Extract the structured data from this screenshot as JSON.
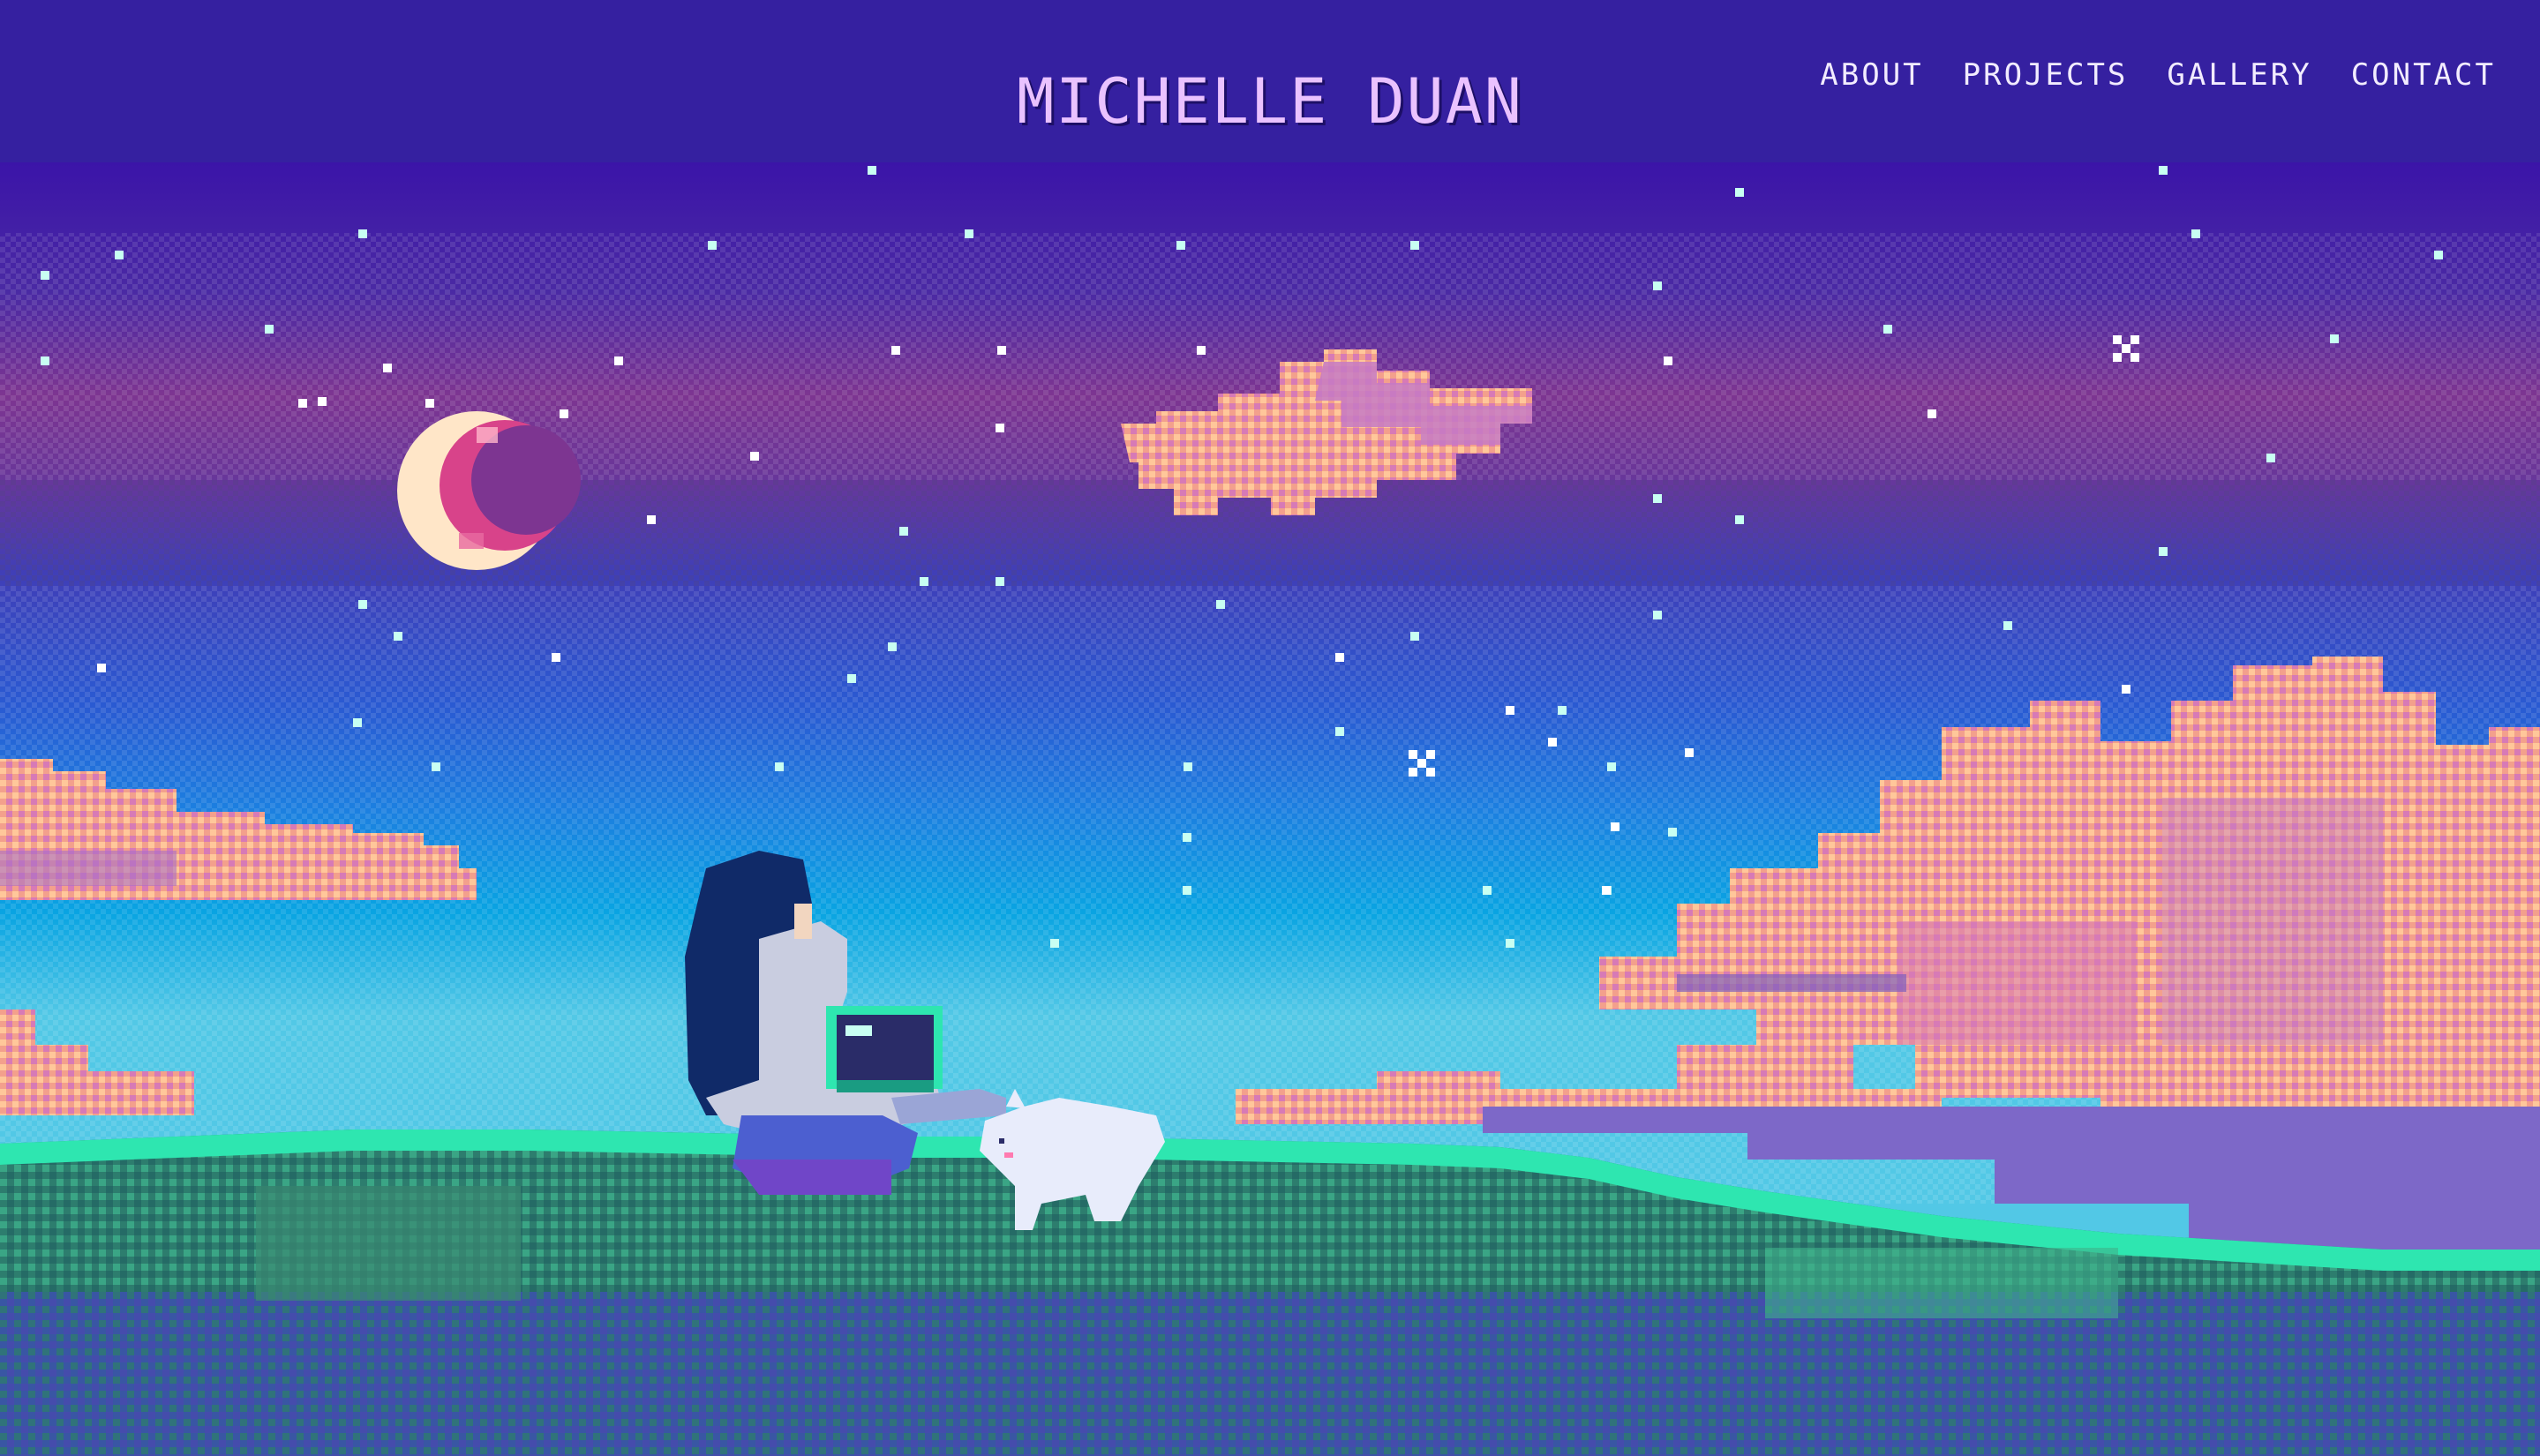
{
  "header": {
    "title": "MICHELLE DUAN",
    "nav": [
      {
        "label": "ABOUT"
      },
      {
        "label": "PROJECTS"
      },
      {
        "label": "GALLERY"
      },
      {
        "label": "CONTACT"
      }
    ]
  },
  "colors": {
    "header_bg": "#3520a0",
    "title_text": "#eac2ff",
    "nav_text": "#f2ecff",
    "sky_top": "#3b14a8",
    "sky_mid": "#7d3591",
    "sky_blue": "#2a64d8",
    "sky_light": "#09a4e2",
    "cloud_peach": "#ffb18e",
    "cloud_pink": "#e07ab6",
    "grass_bright": "#2ee6b0",
    "grass_dark": "#2d7d6e",
    "moon_light": "#ffe6c8",
    "moon_dark": "#d8438a"
  },
  "icons": [
    "moon-icon",
    "sparkle-icon",
    "laptop-icon",
    "cat-icon"
  ]
}
